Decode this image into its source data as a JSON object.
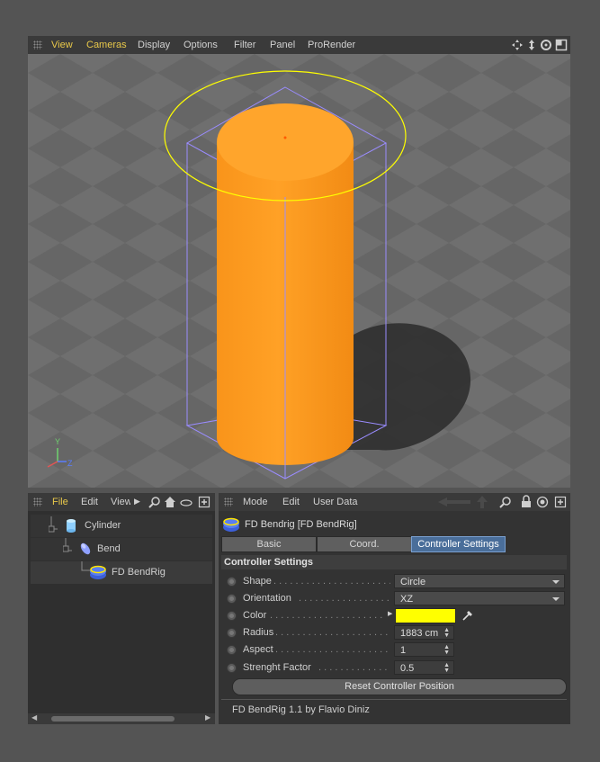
{
  "viewport": {
    "menu": [
      "View",
      "Cameras",
      "Display",
      "Options",
      "Filter",
      "Panel",
      "ProRender"
    ],
    "axis": {
      "y": "Y",
      "z": "Z"
    }
  },
  "object_manager": {
    "menu": [
      "File",
      "Edit",
      "View"
    ],
    "items": [
      {
        "label": "Cylinder",
        "icon": "cylinder-icon"
      },
      {
        "label": "Bend",
        "icon": "bend-deformer-icon"
      },
      {
        "label": "FD BendRig",
        "icon": "bendrig-tag-icon"
      }
    ]
  },
  "attribute_manager": {
    "menu": [
      "Mode",
      "Edit",
      "User Data"
    ],
    "object_title": "FD Bendrig [FD BendRig]",
    "tabs": [
      "Basic",
      "Coord.",
      "Controller Settings"
    ],
    "selected_tab": "Controller Settings",
    "section_title": "Controller Settings",
    "properties": {
      "shape": {
        "label": "Shape",
        "value": "Circle"
      },
      "orientation": {
        "label": "Orientation",
        "value": "XZ"
      },
      "color": {
        "label": "Color",
        "value": "#ffff00"
      },
      "radius": {
        "label": "Radius",
        "value": "1883 cm"
      },
      "aspect": {
        "label": "Aspect",
        "value": "1"
      },
      "strength": {
        "label": "Strenght Factor",
        "value": "0.5"
      }
    },
    "reset_button": "Reset Controller Position",
    "footer": "FD BendRig 1.1 by Flavio Diniz"
  },
  "colors": {
    "accent_menu": "#e8c84a",
    "object": "#ff9a1a",
    "controller": "#ffff00",
    "bbox": "#9a8cff",
    "selected_tab": "#4a6e9a"
  }
}
